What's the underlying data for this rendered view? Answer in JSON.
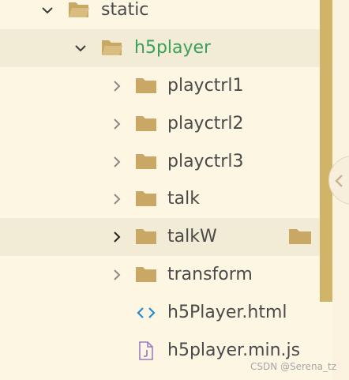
{
  "tree": {
    "items": [
      {
        "label": "static",
        "kind": "folder",
        "expanded": true,
        "icon": "folder-open-icon"
      },
      {
        "label": "h5player",
        "kind": "folder",
        "expanded": true,
        "icon": "folder-open-icon",
        "active": true
      },
      {
        "label": "playctrl1",
        "kind": "folder",
        "expanded": false,
        "icon": "folder-icon"
      },
      {
        "label": "playctrl2",
        "kind": "folder",
        "expanded": false,
        "icon": "folder-icon"
      },
      {
        "label": "playctrl3",
        "kind": "folder",
        "expanded": false,
        "icon": "folder-icon"
      },
      {
        "label": "talk",
        "kind": "folder",
        "expanded": false,
        "icon": "folder-icon"
      },
      {
        "label": "talkW",
        "kind": "folder",
        "expanded": false,
        "icon": "folder-icon",
        "hovered": true
      },
      {
        "label": "transform",
        "kind": "folder",
        "expanded": false,
        "icon": "folder-icon"
      },
      {
        "label": "h5Player.html",
        "kind": "file",
        "icon": "html-code-icon"
      },
      {
        "label": "h5player.min.js",
        "kind": "file",
        "icon": "js-file-icon"
      }
    ]
  },
  "watermark": {
    "text": "CSDN @Serena_tz"
  },
  "colors": {
    "background": "#fdf6e3",
    "highlight": "#f2ebd6",
    "folder": "#c9a865",
    "active_text": "#3aa15a",
    "scrollbar": "#d0b468",
    "html_icon": "#268bd2",
    "js_icon": "#9c7fc2"
  }
}
